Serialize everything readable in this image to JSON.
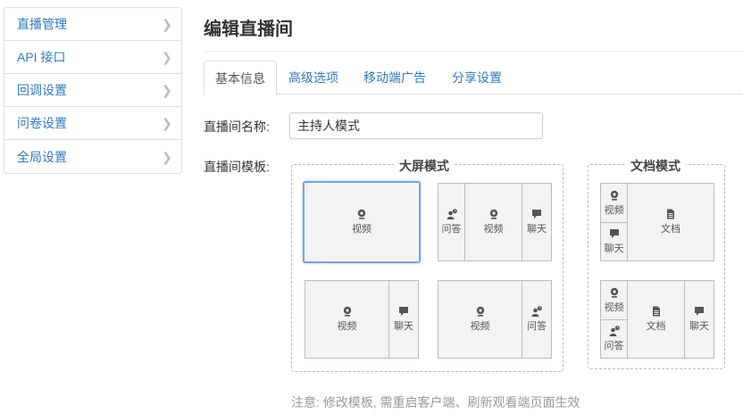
{
  "sidebar": {
    "items": [
      {
        "label": "直播管理"
      },
      {
        "label": "API 接口"
      },
      {
        "label": "回调设置"
      },
      {
        "label": "问卷设置"
      },
      {
        "label": "全局设置"
      }
    ]
  },
  "page": {
    "title": "编辑直播间"
  },
  "tabs": [
    {
      "label": "基本信息"
    },
    {
      "label": "高级选项"
    },
    {
      "label": "移动端广告"
    },
    {
      "label": "分享设置"
    }
  ],
  "form": {
    "name_label": "直播间名称:",
    "name_value": "主持人模式",
    "template_label": "直播间模板:"
  },
  "templates": {
    "large": {
      "title": "大屏模式"
    },
    "doc": {
      "title": "文档模式"
    },
    "labels": {
      "video": "视频",
      "qa": "问答",
      "chat": "聊天",
      "doc": "文档"
    }
  },
  "note": "注意: 修改模板, 需重启客户端、刷新观看端页面生效",
  "colors": {
    "link": "#337ab7",
    "selected_border": "#7ea3de",
    "icon": "#555555"
  }
}
